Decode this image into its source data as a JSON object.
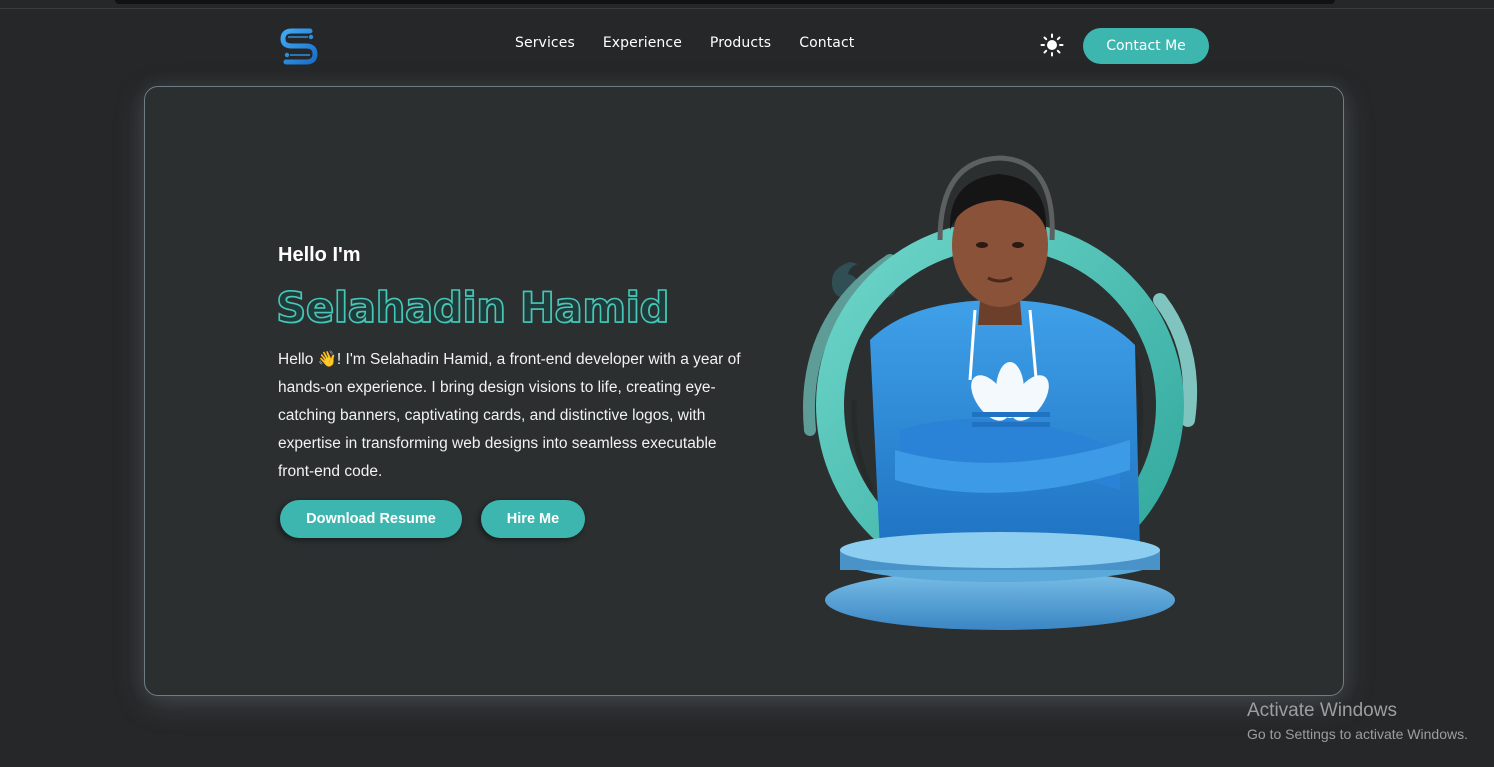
{
  "nav": {
    "links": [
      "Services",
      "Experience",
      "Products",
      "Contact"
    ],
    "contact_button": "Contact Me",
    "logo_icon": "s-circuit-logo",
    "theme_icon": "sun-icon"
  },
  "hero": {
    "greeting": "Hello I'm",
    "name": "Selahadin Hamid",
    "bio": "Hello 👋! I'm Selahadin Hamid, a front-end developer with a year of hands-on experience. I bring design visions to life, creating eye-catching banners, captivating cards, and distinctive logos, with expertise in transforming web designs into seamless executable front-end code.",
    "download_button": "Download Resume",
    "hire_button": "Hire Me"
  },
  "overlay": {
    "activate_title": "Activate Windows",
    "activate_subtitle": "Go to Settings to activate Windows."
  },
  "colors": {
    "background": "#252728",
    "card": "#2b2f30",
    "accent": "#3db6af",
    "name_outline": "#47c7b8"
  }
}
